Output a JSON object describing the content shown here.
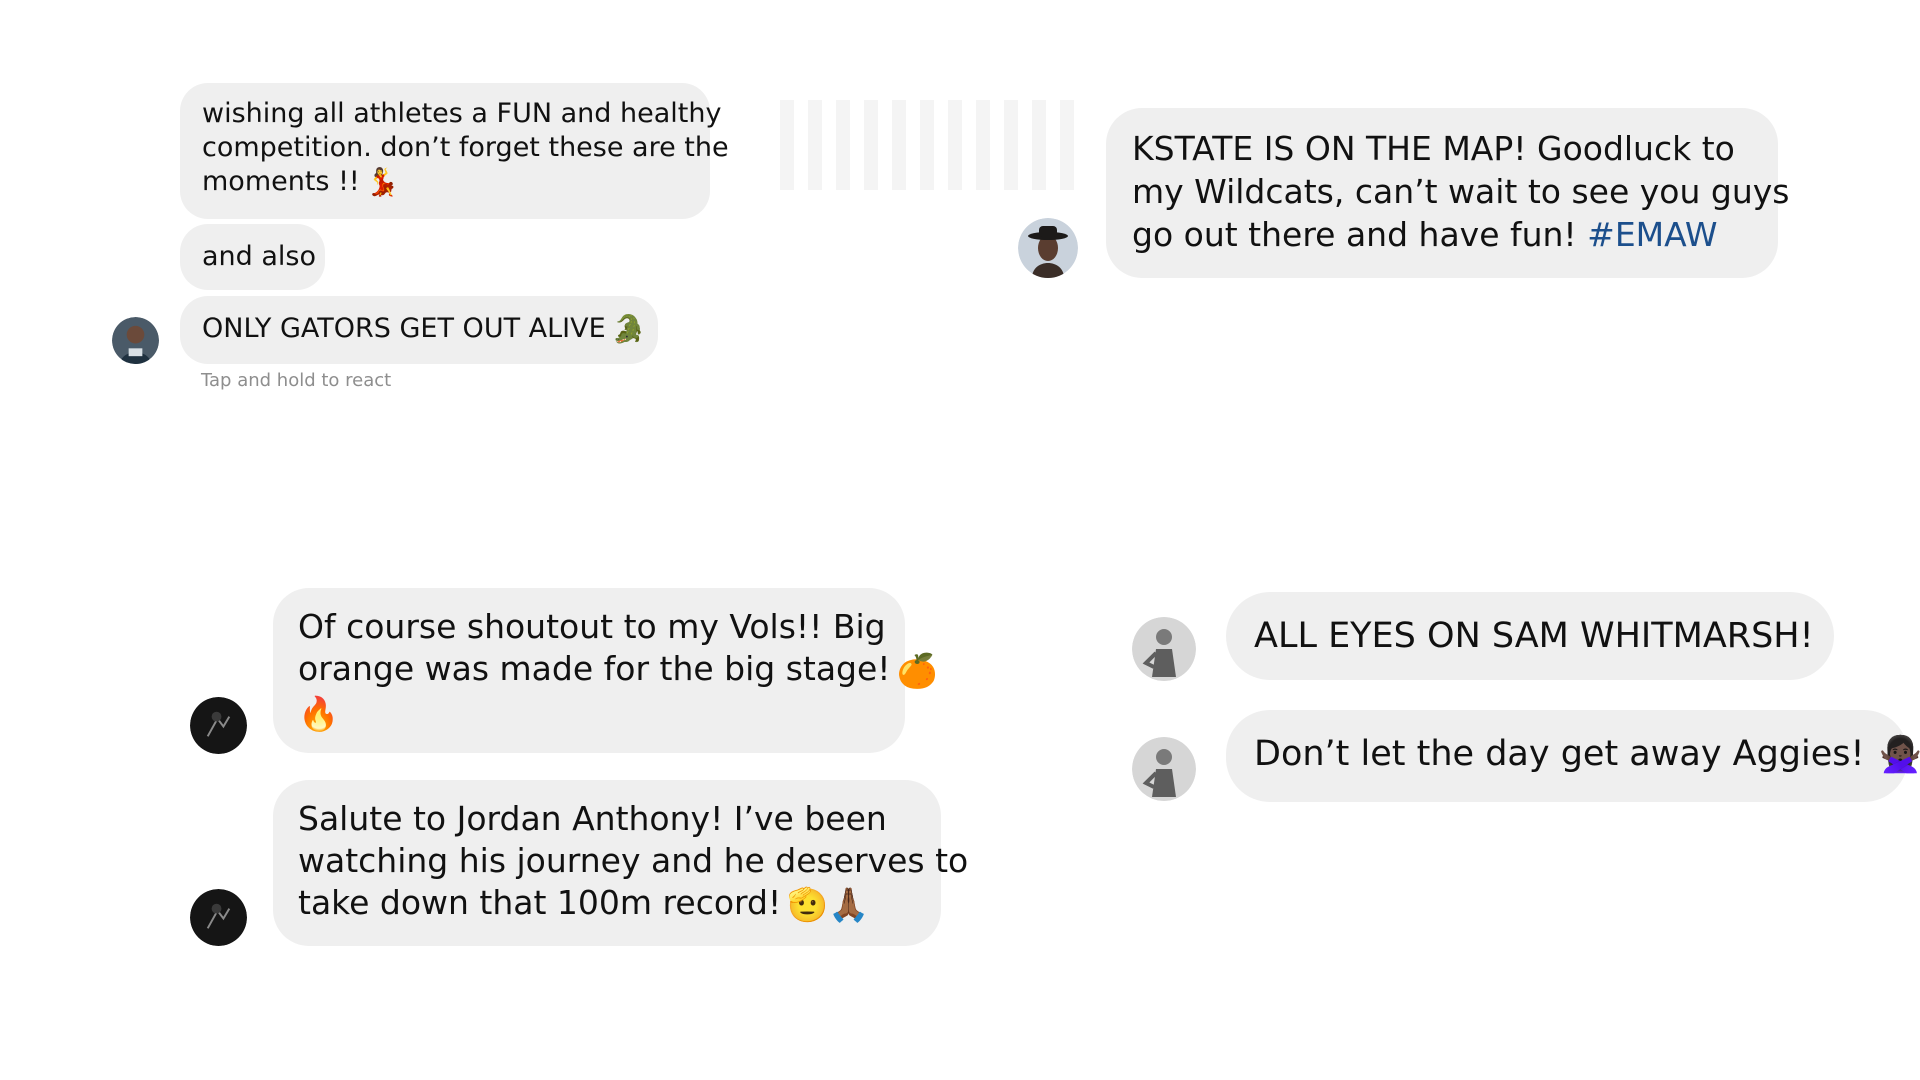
{
  "panels": {
    "top_left": {
      "messages": [
        {
          "lines": [
            "wishing all athletes a FUN and healthy",
            "competition. don’t forget these are the",
            "moments !!"
          ],
          "emoji": "💃"
        },
        {
          "text": "and also"
        },
        {
          "text": "ONLY GATORS GET OUT ALIVE",
          "emoji": "🐊"
        }
      ],
      "hint": "Tap and hold to react"
    },
    "top_right": {
      "messages": [
        {
          "lines": [
            "KSTATE IS ON THE MAP! Goodluck to",
            "my Wildcats, can’t wait to see you guys",
            "go out there and have fun!"
          ],
          "hashtag": "#EMAW"
        }
      ]
    },
    "bottom_left": {
      "messages": [
        {
          "lines": [
            "Of course shoutout to my Vols!! Big",
            "orange was made for the big stage!"
          ],
          "emoji": "🍊",
          "emoji_line3": "🔥"
        },
        {
          "lines": [
            "Salute to Jordan Anthony! I’ve been",
            "watching his journey and he deserves to",
            "take down that 100m record!"
          ],
          "emoji": "🫡🙏🏾"
        }
      ]
    },
    "bottom_right": {
      "messages": [
        {
          "text": "ALL EYES ON SAM WHITMARSH!"
        },
        {
          "text": "Don’t let the day get away Aggies!",
          "emoji": "🙅🏿‍♀️"
        }
      ]
    }
  },
  "icons": {
    "avatar_top_left": "avatar-athlete-icon",
    "avatar_top_right": "avatar-cowboy-hat-icon",
    "avatar_bottom_left": "avatar-dark-icon",
    "avatar_bottom_right": "avatar-gray-icon"
  },
  "colors": {
    "bubble": "#efefef",
    "hashtag": "#1c4f8c",
    "hint": "#8e8e8e"
  }
}
